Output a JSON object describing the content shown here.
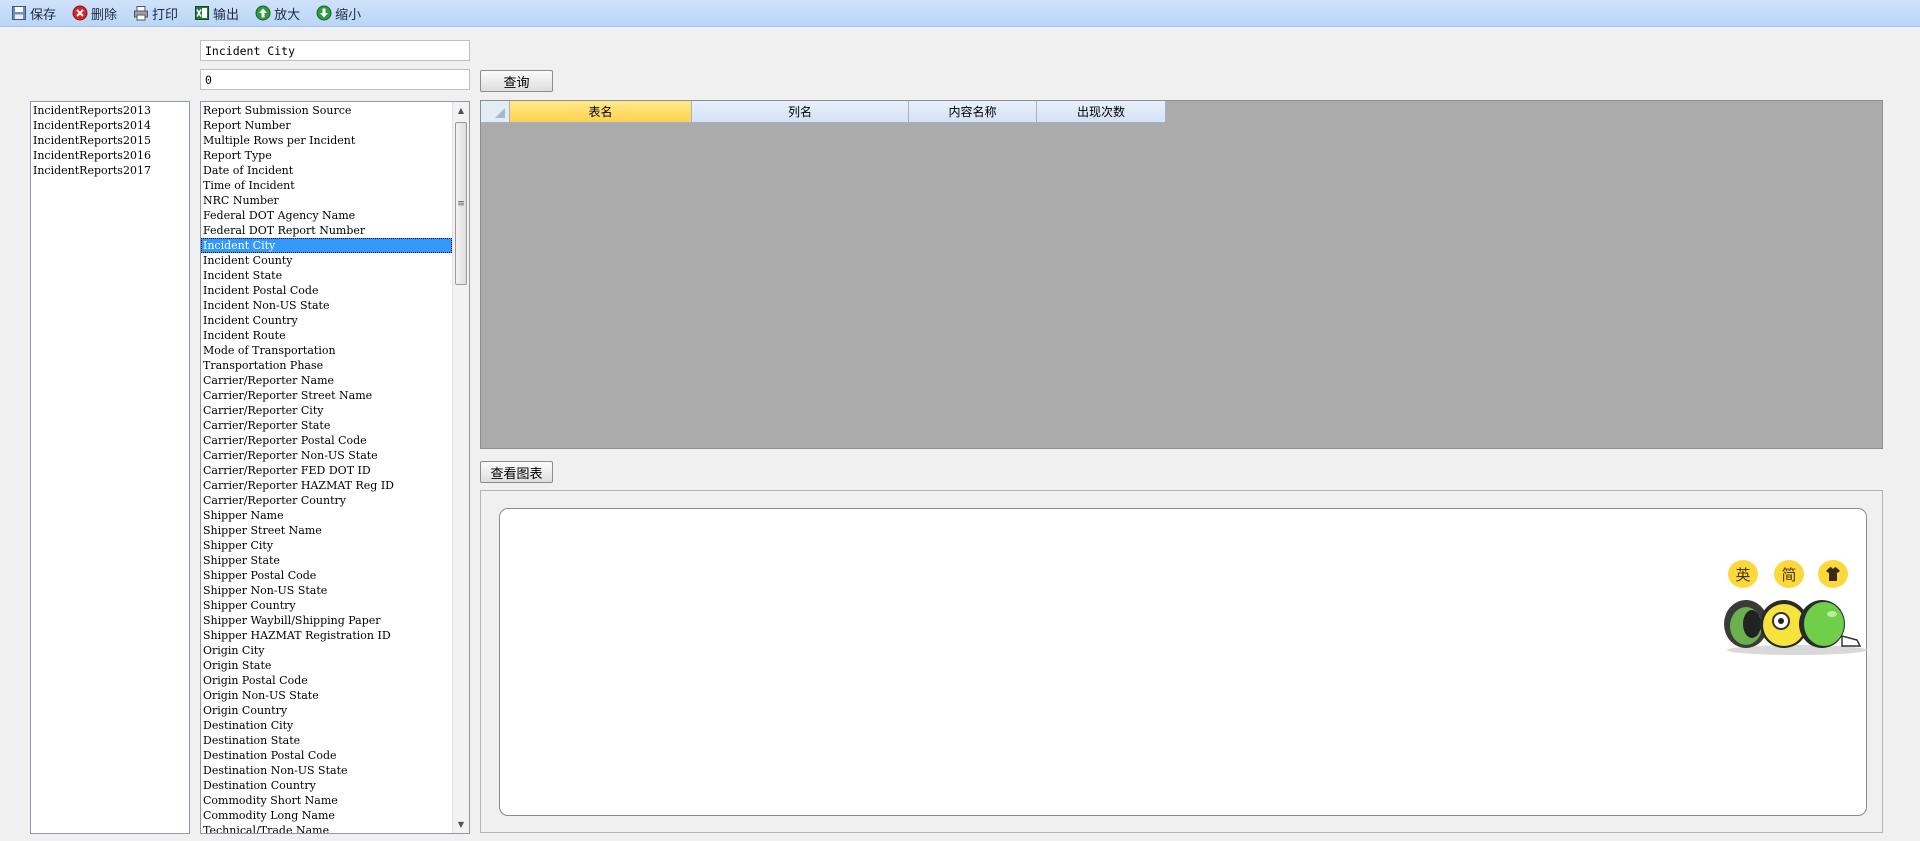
{
  "toolbar": {
    "items": [
      {
        "label": "保存",
        "icon": "save-icon"
      },
      {
        "label": "删除",
        "icon": "delete-icon"
      },
      {
        "label": "打印",
        "icon": "print-icon"
      },
      {
        "label": "输出",
        "icon": "excel-icon"
      },
      {
        "label": "放大",
        "icon": "zoom-in-icon"
      },
      {
        "label": "缩小",
        "icon": "zoom-out-icon"
      }
    ]
  },
  "search": {
    "column_value": "Incident City",
    "count_value": "0",
    "query_button": "查询"
  },
  "tables": {
    "items": [
      "IncidentReports2013",
      "IncidentReports2014",
      "IncidentReports2015",
      "IncidentReports2016",
      "IncidentReports2017"
    ]
  },
  "columns": {
    "selected": "Incident City",
    "items": [
      "Report Submission Source",
      "Report Number",
      "Multiple Rows per Incident",
      "Report Type",
      "Date of Incident",
      "Time of Incident",
      "NRC Number",
      "Federal DOT Agency Name",
      "Federal DOT Report Number",
      "Incident City",
      "Incident County",
      "Incident State",
      "Incident Postal Code",
      "Incident Non-US State",
      "Incident Country",
      "Incident Route",
      "Mode of Transportation",
      "Transportation Phase",
      "Carrier/Reporter Name",
      "Carrier/Reporter Street Name",
      "Carrier/Reporter City",
      "Carrier/Reporter State",
      "Carrier/Reporter Postal Code",
      "Carrier/Reporter Non-US State",
      "Carrier/Reporter FED DOT ID",
      "Carrier/Reporter HAZMAT Reg ID",
      "Carrier/Reporter Country",
      "Shipper Name",
      "Shipper Street Name",
      "Shipper City",
      "Shipper State",
      "Shipper Postal Code",
      "Shipper Non-US State",
      "Shipper Country",
      "Shipper Waybill/Shipping Paper",
      "Shipper HAZMAT Registration ID",
      "Origin City",
      "Origin State",
      "Origin Postal Code",
      "Origin Non-US State",
      "Origin Country",
      "Destination City",
      "Destination State",
      "Destination Postal Code",
      "Destination Non-US State",
      "Destination Country",
      "Commodity Short Name",
      "Commodity Long Name",
      "Technical/Trade Name"
    ]
  },
  "grid": {
    "columns": [
      "表名",
      "列名",
      "内容名称",
      "出现次数"
    ],
    "active_column": "表名"
  },
  "chart": {
    "view_button": "查看图表"
  },
  "mascot": {
    "bubbles": [
      "英",
      "简",
      "shirt-icon"
    ]
  },
  "colors": {
    "toolbar_bg": "#c4dbf8",
    "selection": "#3399ff",
    "grid_bg": "#ababab",
    "active_header": "#ffd24d"
  }
}
